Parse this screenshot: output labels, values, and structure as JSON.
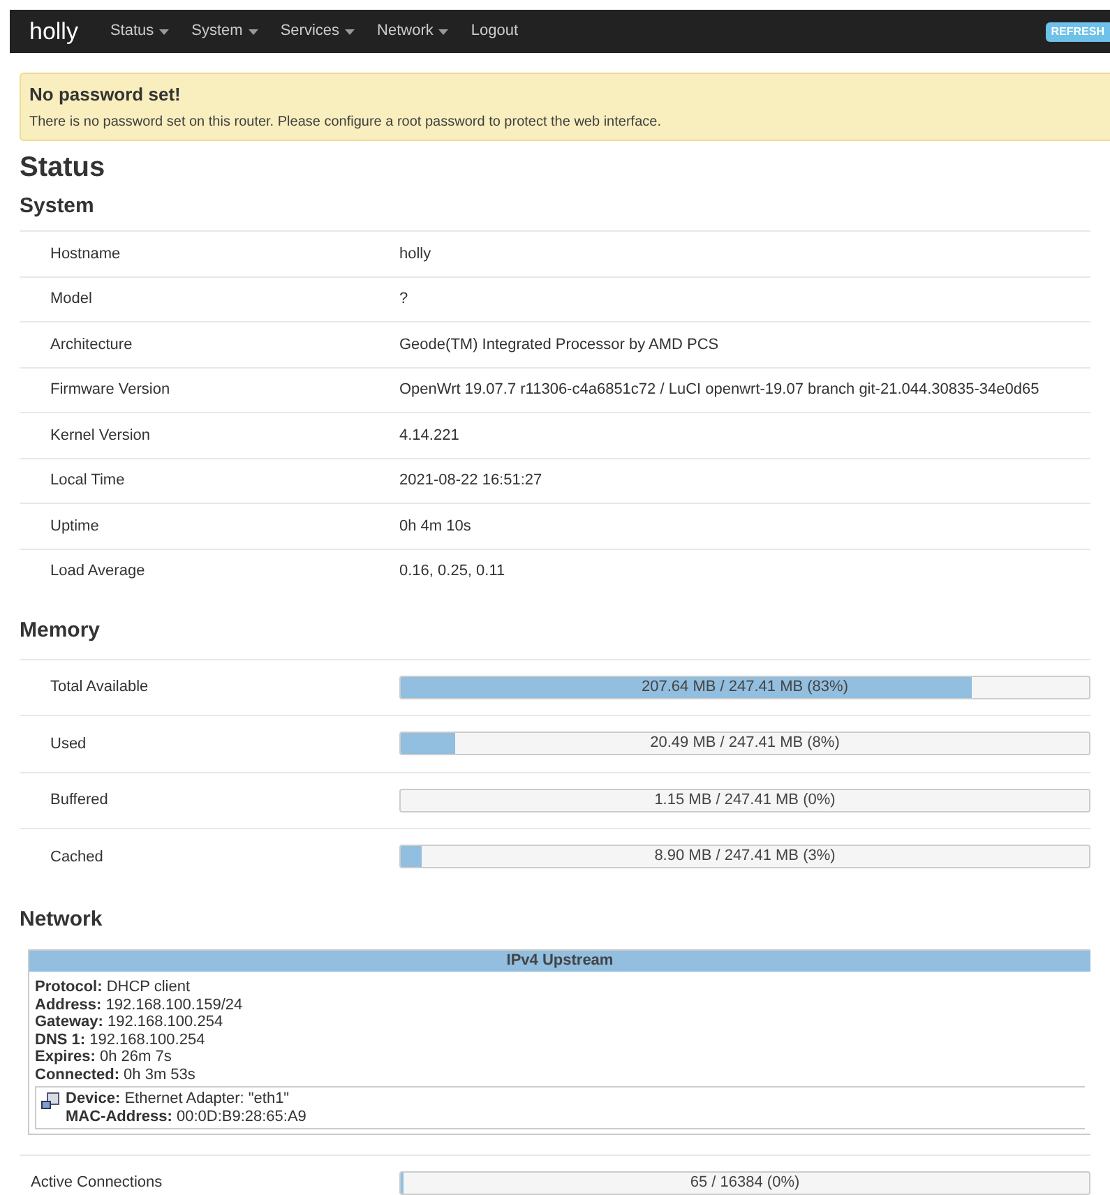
{
  "navbar": {
    "brand": "holly",
    "menu": [
      {
        "label": "Status",
        "dropdown": true
      },
      {
        "label": "System",
        "dropdown": true
      },
      {
        "label": "Services",
        "dropdown": true
      },
      {
        "label": "Network",
        "dropdown": true
      },
      {
        "label": "Logout",
        "dropdown": false
      }
    ],
    "refresh_button": "REFRESH"
  },
  "alert": {
    "title": "No password set!",
    "message": "There is no password set on this router. Please configure a root password to protect the web interface."
  },
  "page_title": "Status",
  "system": {
    "title": "System",
    "rows": [
      {
        "label": "Hostname",
        "value": "holly"
      },
      {
        "label": "Model",
        "value": "?"
      },
      {
        "label": "Architecture",
        "value": "Geode(TM) Integrated Processor by AMD PCS"
      },
      {
        "label": "Firmware Version",
        "value": "OpenWrt 19.07.7 r11306-c4a6851c72 / LuCI openwrt-19.07 branch git-21.044.30835-34e0d65"
      },
      {
        "label": "Kernel Version",
        "value": "4.14.221"
      },
      {
        "label": "Local Time",
        "value": "2021-08-22 16:51:27"
      },
      {
        "label": "Uptime",
        "value": "0h 4m 10s"
      },
      {
        "label": "Load Average",
        "value": "0.16, 0.25, 0.11"
      }
    ]
  },
  "memory": {
    "title": "Memory",
    "rows": [
      {
        "label": "Total Available",
        "reading": "207.64 MB / 247.41 MB (83%)",
        "level": 0.83
      },
      {
        "label": "Used",
        "reading": "20.49 MB / 247.41 MB (8%)",
        "level": 0.08
      },
      {
        "label": "Buffered",
        "reading": "1.15 MB / 247.41 MB (0%)",
        "level": 0
      },
      {
        "label": "Cached",
        "reading": "8.90 MB / 247.41 MB (3%)",
        "level": 0.03
      }
    ]
  },
  "network": {
    "title": "Network",
    "upstream": {
      "header": "IPv4 Upstream",
      "lines": [
        "**Protocol:** DHCP client",
        "**Address:** 192.168.100.159/24",
        "**Gateway:** 192.168.100.254",
        "**DNS 1:** 192.168.100.254",
        "**Expires:** 0h 26m 7s",
        "**Connected:** 0h 3m 53s"
      ],
      "device_lines": [
        "**Device:** Ethernet Adapter: \"eth1\"",
        "**MAC-Address:** 00:0D:B9:28:65:A9"
      ]
    },
    "rows": [
      {
        "label": "Active Connections",
        "reading": "65 / 16384 (0%)",
        "level": 0.004
      }
    ]
  }
}
